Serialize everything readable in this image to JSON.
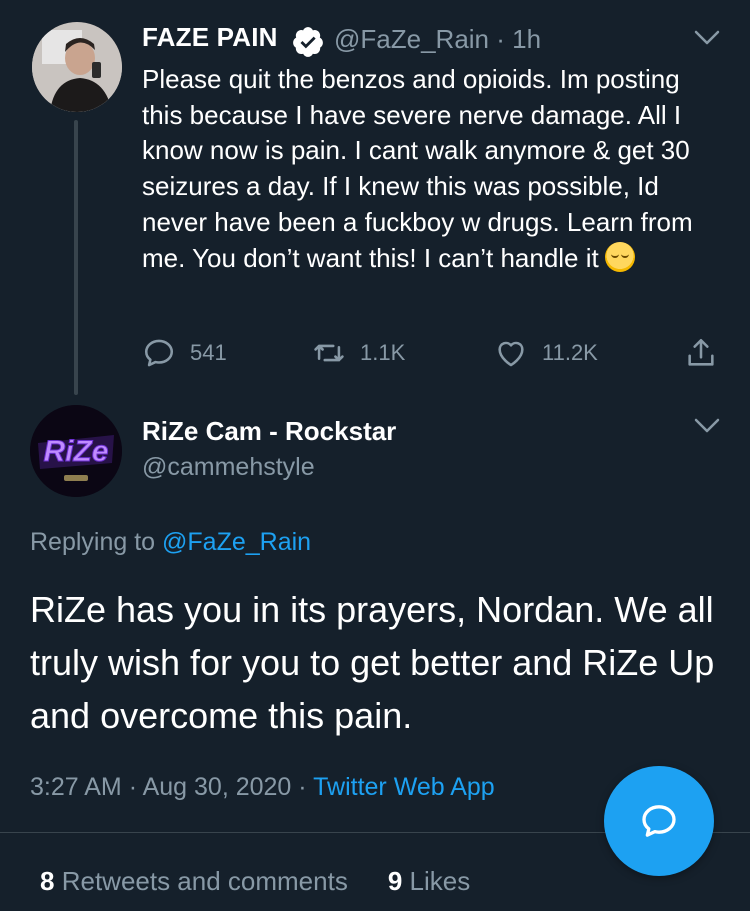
{
  "parent_tweet": {
    "display_name": "FAZE PAIN",
    "handle": "@FaZe_Rain",
    "time_sep": "·",
    "time_ago": "1h",
    "text": "Please quit the benzos and opioids. Im posting this because I have severe nerve damage. All I know now is pain. I cant walk anymore & get 30 seizures a day. If I knew this was possible, Id never have been a fuckboy w drugs. Learn from me. You don’t want this! I can’t handle it",
    "emoji": "pensive-face",
    "reply_count": "541",
    "retweet_count": "1.1K",
    "like_count": "11.2K"
  },
  "reply_tweet": {
    "display_name": "RiZe Cam - Rockstar",
    "handle": "@cammehstyle",
    "replying_prefix": "Replying to",
    "replying_to": "@FaZe_Rain",
    "text": "RiZe has you in its prayers, Nordan. We all truly wish for you to get better and RiZe Up and overcome this pain.",
    "time": "3:27 AM",
    "sep1": "·",
    "date": "Aug 30, 2020",
    "sep2": "·",
    "source": "Twitter Web App",
    "avatar_text": "RiZe"
  },
  "stats": {
    "retweets_count": "8",
    "retweets_label": "Retweets and comments",
    "likes_count": "9",
    "likes_label": "Likes"
  },
  "colors": {
    "background": "#15202b",
    "accent": "#1da1f2",
    "muted": "#8899a6",
    "divider": "#38444d"
  }
}
